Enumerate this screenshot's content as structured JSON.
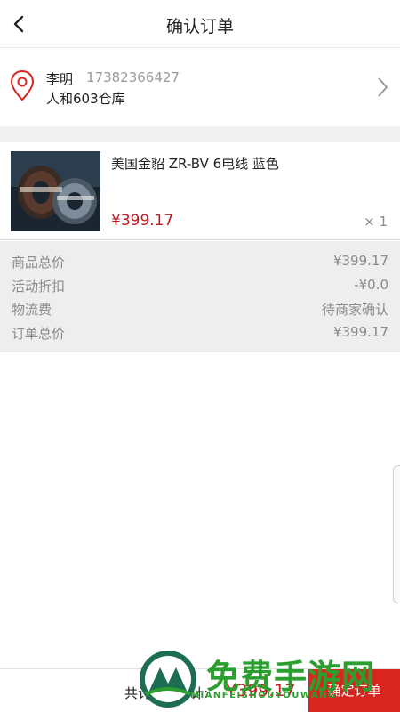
{
  "header": {
    "title": "确认订单"
  },
  "address": {
    "name": "李明",
    "phone": "17382366427",
    "location": "人和603仓库"
  },
  "product": {
    "title": "美国金貂 ZR-BV 6电线   蓝色",
    "price": "¥399.17",
    "quantity": "× 1"
  },
  "summary": [
    {
      "label": "商品总价",
      "value": "¥399.17"
    },
    {
      "label": "活动折扣",
      "value": "-¥0.0"
    },
    {
      "label": "物流费",
      "value": "待商家确认"
    },
    {
      "label": "订单总价",
      "value": "¥399.17"
    }
  ],
  "footer": {
    "total_label": "共计1件 合计:",
    "total_price": "¥399.17",
    "confirm_label": "确定订单"
  },
  "watermark": {
    "text": "免费手游网",
    "sub": "MIANFEISHOUYOUWANG"
  },
  "colors": {
    "accent_red": "#c8161d",
    "confirm_bg": "#d8261f",
    "watermark_green": "#2a9e2f"
  }
}
